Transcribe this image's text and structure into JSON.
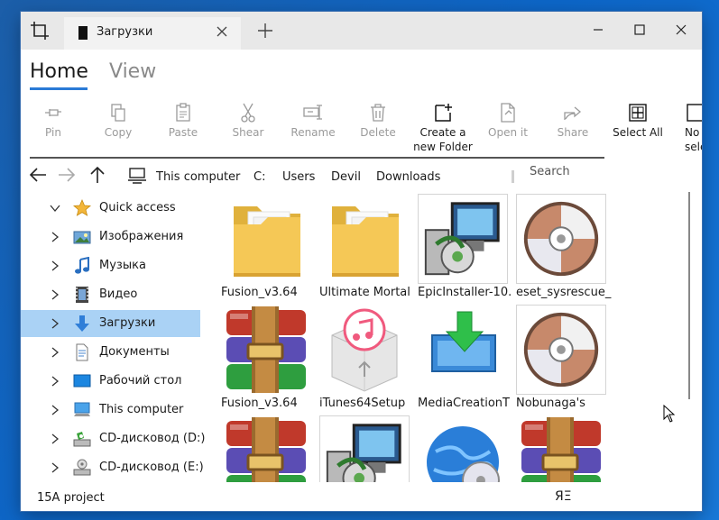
{
  "titlebar": {
    "tab_title": "Загрузки",
    "icons": [
      "crop-icon",
      "folder-tab-icon",
      "close-icon",
      "plus-icon",
      "minimize-icon",
      "maximize-icon",
      "close-window-icon"
    ]
  },
  "ribbon": {
    "tabs": [
      "Home",
      "View"
    ],
    "active_tab": "Home",
    "buttons": [
      {
        "label": "Pin",
        "enabled": false,
        "icon": "pin-icon"
      },
      {
        "label": "Copy",
        "enabled": false,
        "icon": "copy-icon"
      },
      {
        "label": "Paste",
        "enabled": false,
        "icon": "paste-icon"
      },
      {
        "label": "Shear",
        "enabled": false,
        "icon": "scissors-icon"
      },
      {
        "label": "Rename",
        "enabled": false,
        "icon": "rename-icon"
      },
      {
        "label": "Delete",
        "enabled": false,
        "icon": "trash-icon"
      },
      {
        "label": "Create a new Folder",
        "label_line1": "Create a",
        "label_line2": "new Folder",
        "enabled": true,
        "icon": "new-folder-icon"
      },
      {
        "label": "Open it",
        "enabled": false,
        "icon": "open-file-icon"
      },
      {
        "label": "Share",
        "enabled": false,
        "icon": "share-icon"
      },
      {
        "label": "Select All",
        "enabled": true,
        "icon": "select-all-icon"
      },
      {
        "label_line1": "No",
        "label_line2": "selec",
        "enabled": true,
        "icon": "select-none-icon"
      }
    ]
  },
  "nav": {
    "breadcrumbs": [
      "This computer",
      "C:",
      "Users",
      "Devil",
      "Downloads"
    ],
    "search_placeholder": "Search"
  },
  "sidebar": {
    "items": [
      {
        "label": "Quick access",
        "icon": "star-icon",
        "expanded": true,
        "selected": false
      },
      {
        "label": "Изображения",
        "icon": "pictures-icon",
        "expanded": false,
        "selected": false
      },
      {
        "label": "Музыка",
        "icon": "music-icon",
        "expanded": false,
        "selected": false
      },
      {
        "label": "Видео",
        "icon": "video-icon",
        "expanded": false,
        "selected": false
      },
      {
        "label": "Загрузки",
        "icon": "download-icon",
        "expanded": false,
        "selected": true
      },
      {
        "label": "Документы",
        "icon": "documents-icon",
        "expanded": false,
        "selected": false
      },
      {
        "label": "Рабочий стол",
        "icon": "desktop-icon",
        "expanded": false,
        "selected": false
      },
      {
        "label": "This computer",
        "icon": "computer-icon",
        "expanded": false,
        "selected": false
      },
      {
        "label": "CD-дисковод (D:)",
        "icon": "cd-drive-icon",
        "expanded": false,
        "selected": false
      },
      {
        "label": "CD-дисковод (E:)",
        "icon": "cd-drive-icon",
        "expanded": false,
        "selected": false
      }
    ]
  },
  "files": [
    {
      "name": "Fusion_v3.64",
      "type": "folder-icon"
    },
    {
      "name": "Ultimate Mortal",
      "type": "folder-icon"
    },
    {
      "name": "EpicInstaller-10.",
      "type": "installer-icon"
    },
    {
      "name": "eset_sysrescue_l",
      "type": "disc-image-icon"
    },
    {
      "name": "Fusion_v3.64",
      "type": "winrar-icon"
    },
    {
      "name": "iTunes64Setup",
      "type": "itunes-package-icon"
    },
    {
      "name": "MediaCreationT",
      "type": "media-creation-icon"
    },
    {
      "name": "Nobunaga's",
      "type": "disc-image-icon"
    },
    {
      "name": "",
      "type": "winrar-icon"
    },
    {
      "name": "",
      "type": "installer-icon"
    },
    {
      "name": "",
      "type": "globe-disc-icon"
    },
    {
      "name": "",
      "type": "winrar-icon"
    }
  ],
  "status": {
    "text": "15A project",
    "view_toggle": "ЯΞ"
  },
  "colors": {
    "accent": "#2a7ad6",
    "selection": "#aad2f5",
    "disabled_text": "#9a9a9a",
    "desktop": "#0d66c8"
  }
}
